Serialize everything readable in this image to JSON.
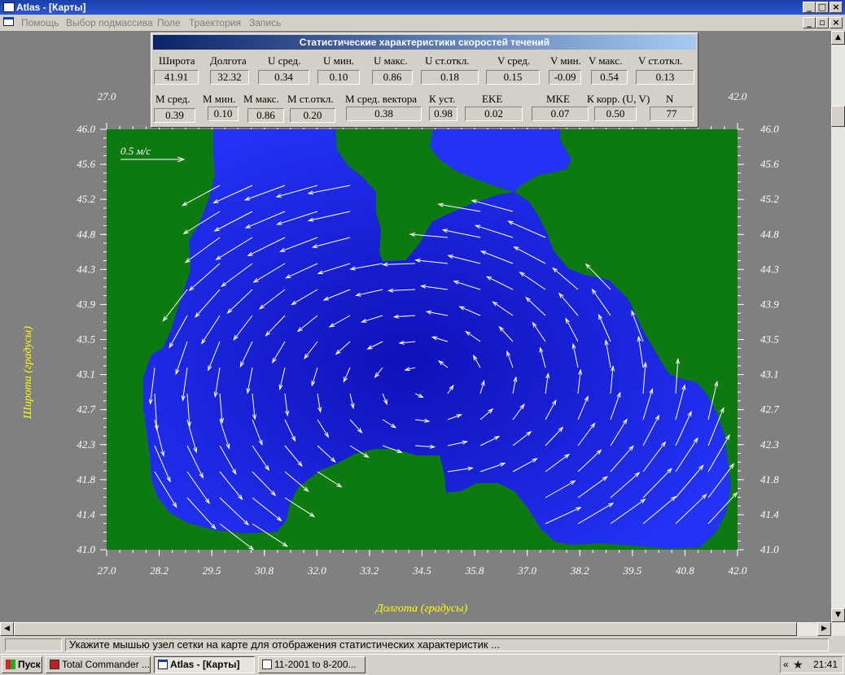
{
  "window": {
    "title": "Atlas - [Карты]"
  },
  "menu": [
    "Помощь",
    "Выбор подмассива",
    "Поле",
    "Траектория",
    "Запись"
  ],
  "stats_panel": {
    "title": "Статистические характеристики скоростей течений",
    "row1": [
      {
        "label": "Широта",
        "value": "41.91"
      },
      {
        "label": "Долгота",
        "value": "32.32"
      },
      {
        "label": "U сред.",
        "value": "0.34"
      },
      {
        "label": "U мин.",
        "value": "0.10"
      },
      {
        "label": "U макс.",
        "value": "0.86"
      },
      {
        "label": "U ст.откл.",
        "value": "0.18"
      },
      {
        "label": "V сред.",
        "value": "0.15"
      },
      {
        "label": "V мин.",
        "value": "-0.09"
      },
      {
        "label": "V макс.",
        "value": "0.54"
      },
      {
        "label": "V ст.откл.",
        "value": "0.13"
      }
    ],
    "row2": [
      {
        "label": "М сред.",
        "value": "0.39"
      },
      {
        "label": "М мин.",
        "value": "0.10"
      },
      {
        "label": "М макс.",
        "value": "0.86"
      },
      {
        "label": "М ст.откл.",
        "value": "0.20"
      },
      {
        "label": "М сред. вектора",
        "value": "0.38"
      },
      {
        "label": "К уст.",
        "value": "0.98"
      },
      {
        "label": "EKE",
        "value": "0.02"
      },
      {
        "label": "MKE",
        "value": "0.07"
      },
      {
        "label": "К корр. (U, V)",
        "value": "0.50"
      },
      {
        "label": "N",
        "value": "77"
      }
    ]
  },
  "map": {
    "scale_label": "0.5 м/с",
    "xlabel": "Долгота (градусы)",
    "ylabel": "Широта (градусы)",
    "x_ticks": [
      "27.0",
      "28.2",
      "29.5",
      "30.8",
      "32.0",
      "33.2",
      "34.5",
      "35.8",
      "37.0",
      "38.2",
      "39.5",
      "40.8",
      "42.0"
    ],
    "y_ticks": [
      "46.0",
      "45.6",
      "45.2",
      "44.8",
      "44.3",
      "43.9",
      "43.5",
      "43.1",
      "42.7",
      "42.3",
      "41.8",
      "41.4",
      "41.0"
    ],
    "xlim": [
      27.0,
      42.0
    ],
    "ylim": [
      41.0,
      46.0
    ],
    "colors": {
      "land": "#0d7a10",
      "sea": "#1a1ae6",
      "vectors": "#ffffff"
    }
  },
  "status": {
    "message": "Укажите мышью узел сетки на карте для отображения статистических характеристик ..."
  },
  "taskbar": {
    "start": "Пуск",
    "items": [
      "Total Commander ...",
      "Atlas - [Карты]",
      "11-2001 to 8-200..."
    ],
    "chevron": "«",
    "clock": "21:41"
  }
}
